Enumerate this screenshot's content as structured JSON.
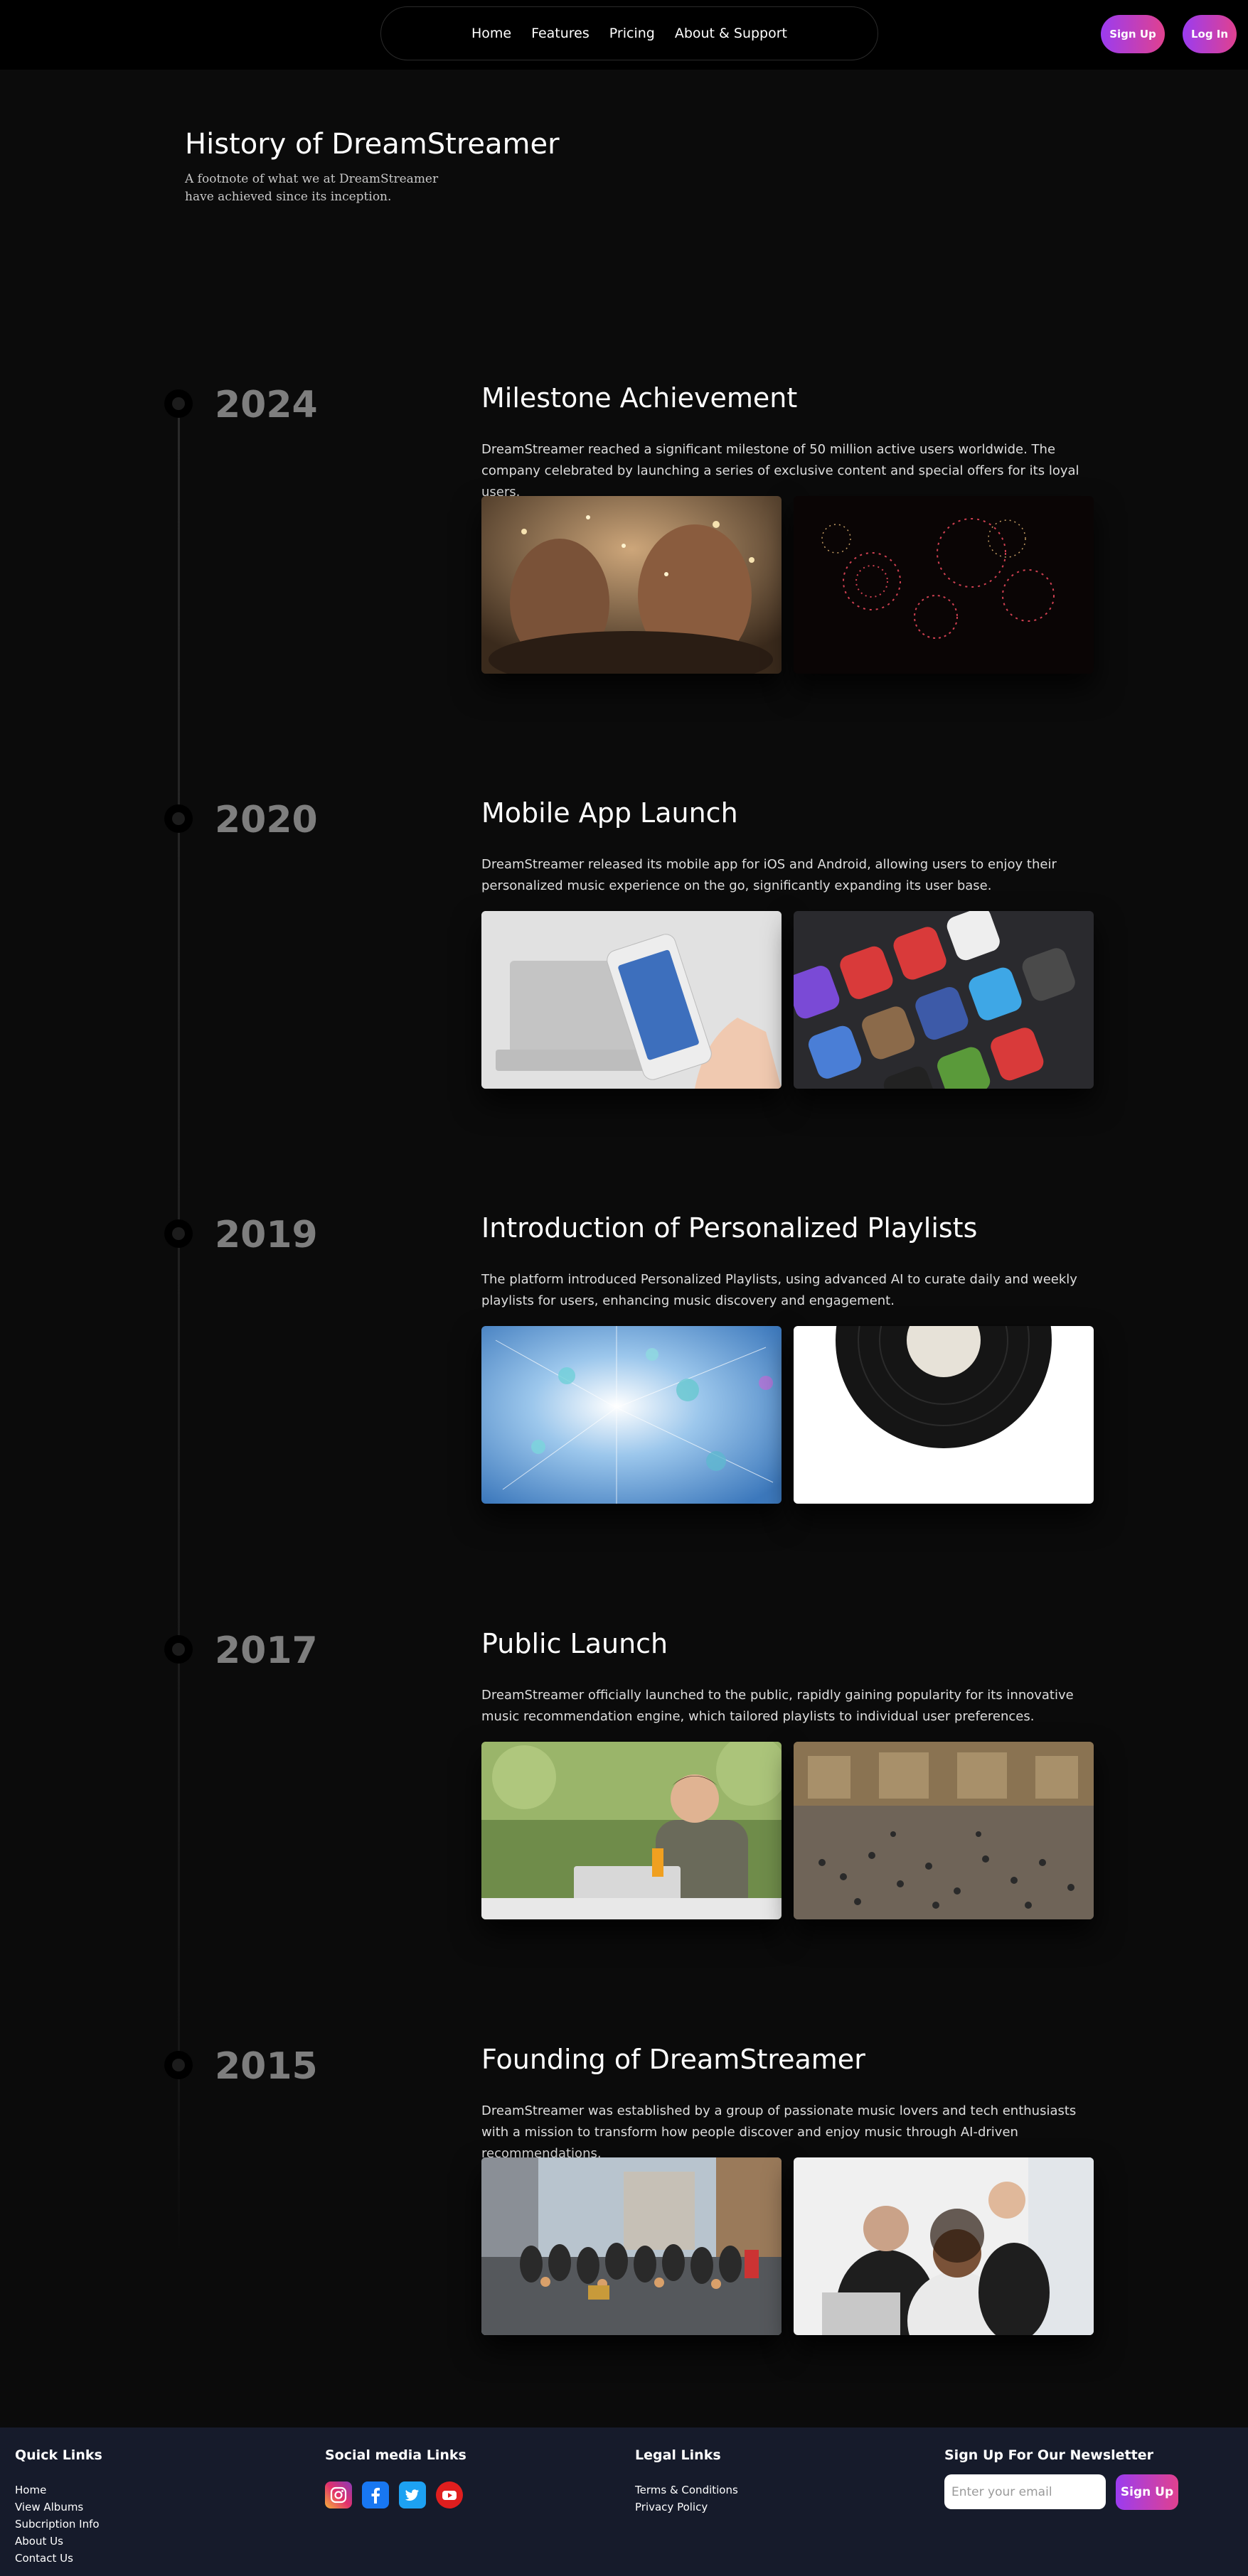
{
  "nav": {
    "links": [
      "Home",
      "Features",
      "Pricing",
      "About & Support"
    ],
    "signup_label": "Sign Up",
    "login_label": "Log In"
  },
  "hero": {
    "title": "History of DreamStreamer",
    "subtitle": "A footnote of what we at DreamStreamer have achieved since its inception."
  },
  "timeline": [
    {
      "year": "2024",
      "title": "Milestone Achievement",
      "description": "DreamStreamer reached a significant milestone of 50 million active users worldwide. The company celebrated by launching a series of exclusive content and special offers for its loyal users.",
      "images": [
        "celebration-toast-photo",
        "fireworks-photo"
      ]
    },
    {
      "year": "2020",
      "title": "Mobile App Launch",
      "description": "DreamStreamer released its mobile app for iOS and Android, allowing users to enjoy their personalized music experience on the go, significantly expanding its user base.",
      "images": [
        "hand-holding-phone-photo",
        "app-icons-photo"
      ]
    },
    {
      "year": "2019",
      "title": "Introduction of Personalized Playlists",
      "description": "The platform introduced Personalized Playlists, using advanced AI to curate daily and weekly playlists for users, enhancing music discovery and engagement.",
      "images": [
        "crystal-burst-photo",
        "vinyl-record-photo"
      ]
    },
    {
      "year": "2017",
      "title": "Public Launch",
      "description": "DreamStreamer officially launched to the public, rapidly gaining popularity for its innovative music recommendation engine, which tailored playlists to individual user preferences.",
      "images": [
        "man-with-laptop-photo",
        "crowded-station-photo"
      ]
    },
    {
      "year": "2015",
      "title": "Founding of DreamStreamer",
      "description": "DreamStreamer was established by a group of passionate music lovers and tech enthusiasts with a mission to transform how people discover and enjoy music through AI-driven recommendations.",
      "images": [
        "group-photo-street",
        "team-at-laptop-photo"
      ]
    }
  ],
  "footer": {
    "quick_links_title": "Quick Links",
    "quick_links": [
      "Home",
      "View Albums",
      "Subcription Info",
      "About Us",
      "Contact Us"
    ],
    "social_title": "Social media Links",
    "social_icons": [
      "instagram-icon",
      "facebook-icon",
      "twitter-icon",
      "youtube-icon"
    ],
    "legal_title": "Legal Links",
    "legal_links": [
      "Terms & Conditions",
      "Privacy Policy"
    ],
    "newsletter_title": "Sign Up For Our Newsletter",
    "email_placeholder": "Enter your email",
    "newsletter_button": "Sign Up"
  },
  "colors": {
    "background": "#0b0b0b",
    "footer": "#161b2b",
    "accent_gradient_start": "#9b3cf0",
    "accent_gradient_end": "#e0418f",
    "year_text": "#7e7e7e"
  }
}
